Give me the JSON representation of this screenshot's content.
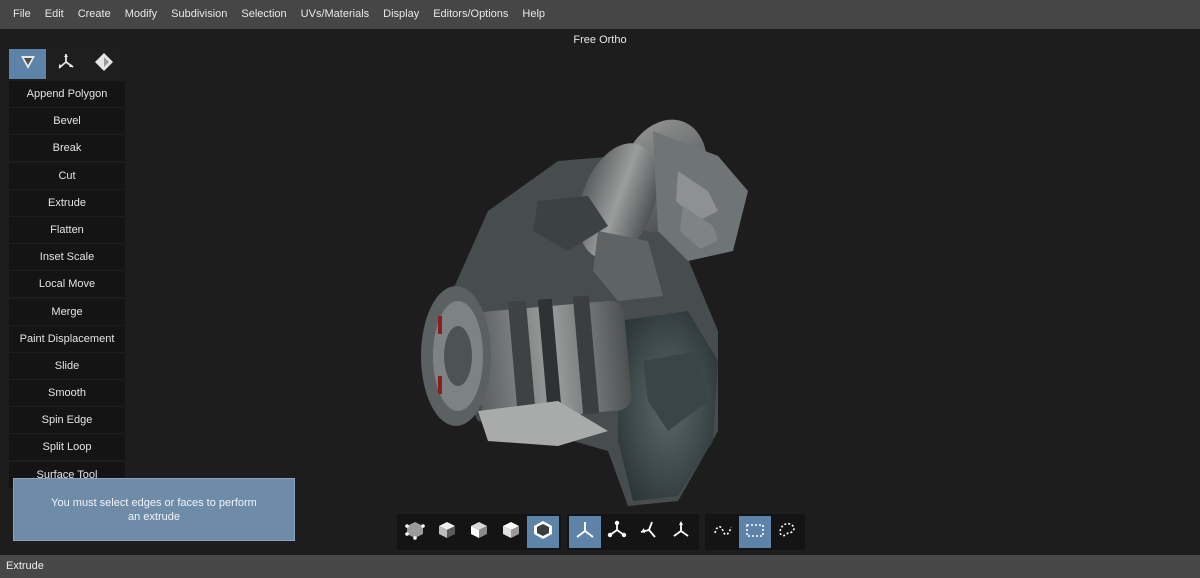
{
  "menubar": {
    "items": [
      "File",
      "Edit",
      "Create",
      "Modify",
      "Subdivision",
      "Selection",
      "UVs/Materials",
      "Display",
      "Editors/Options",
      "Help"
    ]
  },
  "viewport": {
    "title": "Free Ortho"
  },
  "tool_panel": {
    "modes": [
      {
        "icon": "mesh-mode-icon",
        "active": true
      },
      {
        "icon": "transform-mode-icon",
        "active": false
      },
      {
        "icon": "uv-mode-icon",
        "active": false
      }
    ],
    "tools": [
      "Append Polygon",
      "Bevel",
      "Break",
      "Cut",
      "Extrude",
      "Flatten",
      "Inset Scale",
      "Local Move",
      "Merge",
      "Paint Displacement",
      "Slide",
      "Smooth",
      "Spin Edge",
      "Split Loop",
      "Surface Tool"
    ]
  },
  "toast": {
    "message": "You must select edges or faces to perform an extrude"
  },
  "bottom_toolbar": {
    "selection_modes": [
      {
        "icon": "object-select-icon",
        "active": false
      },
      {
        "icon": "face-select-icon",
        "active": false
      },
      {
        "icon": "edge-select-icon",
        "active": false
      },
      {
        "icon": "vertex-select-icon",
        "active": false
      },
      {
        "icon": "mesh-select-icon",
        "active": true
      }
    ],
    "transform_modes": [
      {
        "icon": "local-axis-icon",
        "active": true
      },
      {
        "icon": "world-axis-icon",
        "active": false
      },
      {
        "icon": "screen-axis-icon",
        "active": false
      },
      {
        "icon": "normal-axis-icon",
        "active": false
      }
    ],
    "marquee_modes": [
      {
        "icon": "lasso-select-icon",
        "active": false
      },
      {
        "icon": "rect-select-icon",
        "active": true
      },
      {
        "icon": "paint-select-icon",
        "active": false
      }
    ]
  },
  "statusbar": {
    "text": "Extrude"
  },
  "colors": {
    "accent": "#5e83a8",
    "menubar_bg": "#464646",
    "viewport_bg": "#1d1d1d",
    "toast_bg": "#6e8ba8"
  }
}
